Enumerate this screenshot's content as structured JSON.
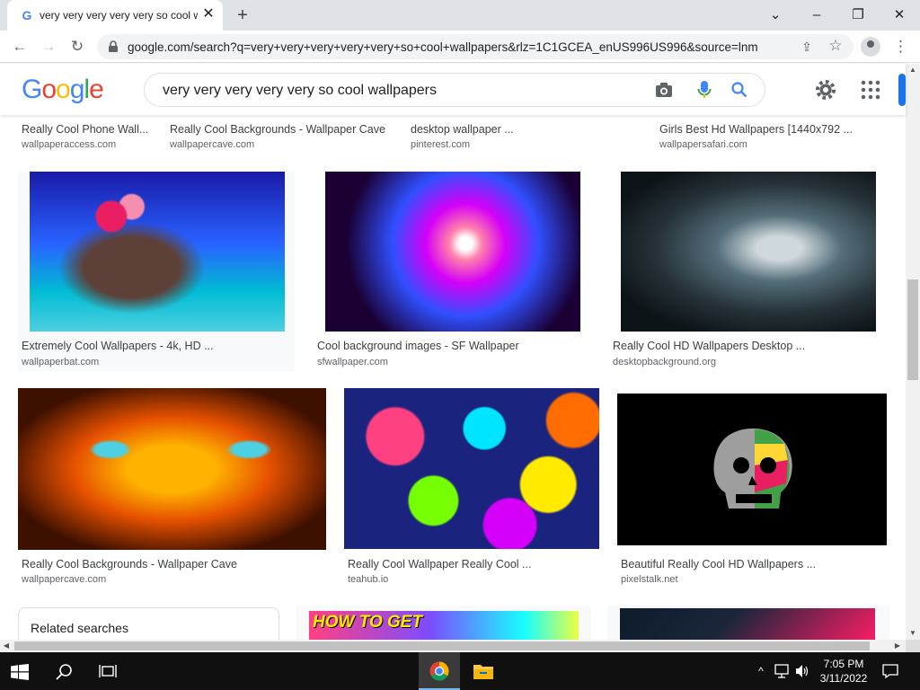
{
  "browser": {
    "tab_title": "very very very very very so cool wallpapers - Google Search",
    "new_tab_label": "+",
    "url": "google.com/search?q=very+very+very+very+very+so+cool+wallpapers&rlz=1C1GCEA_enUS996US996&source=lnm"
  },
  "google": {
    "logo_letters": [
      "G",
      "o",
      "o",
      "g",
      "l",
      "e"
    ],
    "logo_colors": [
      "#4285f4",
      "#ea4335",
      "#fbbc05",
      "#4285f4",
      "#34a853",
      "#ea4335"
    ],
    "query": "very very very very very so cool wallpapers"
  },
  "results": [
    {
      "title": "Really Cool Phone Wall...",
      "source": "wallpaperaccess.com"
    },
    {
      "title": "Really Cool Backgrounds - Wallpaper Cave",
      "source": "wallpapercave.com"
    },
    {
      "title": "desktop wallpaper ...",
      "source": "pinterest.com"
    },
    {
      "title": "Girls Best Hd Wallpapers [1440x792 ...",
      "source": "wallpapersafari.com"
    },
    {
      "title": "Extremely Cool Wallpapers - 4k, HD ...",
      "source": "wallpaperbat.com"
    },
    {
      "title": "Cool background images - SF Wallpaper",
      "source": "sfwallpaper.com"
    },
    {
      "title": "Really Cool HD Wallpapers Desktop ...",
      "source": "desktopbackground.org"
    },
    {
      "title": "Really Cool Backgrounds - Wallpaper Cave",
      "source": "wallpapercave.com"
    },
    {
      "title": "Really Cool Wallpaper Really Cool ...",
      "source": "teahub.io"
    },
    {
      "title": "Beautiful Really Cool HD Wallpapers ...",
      "source": "pixelstalk.net"
    }
  ],
  "partial_image_text": "HOW TO GET",
  "related_searches_label": "Related searches",
  "taskbar": {
    "time": "7:05 PM",
    "date": "3/11/2022"
  },
  "colors": {
    "accent_blue": "#1a73e8",
    "titlebar": "#dee1e6",
    "taskbar": "#101010"
  }
}
